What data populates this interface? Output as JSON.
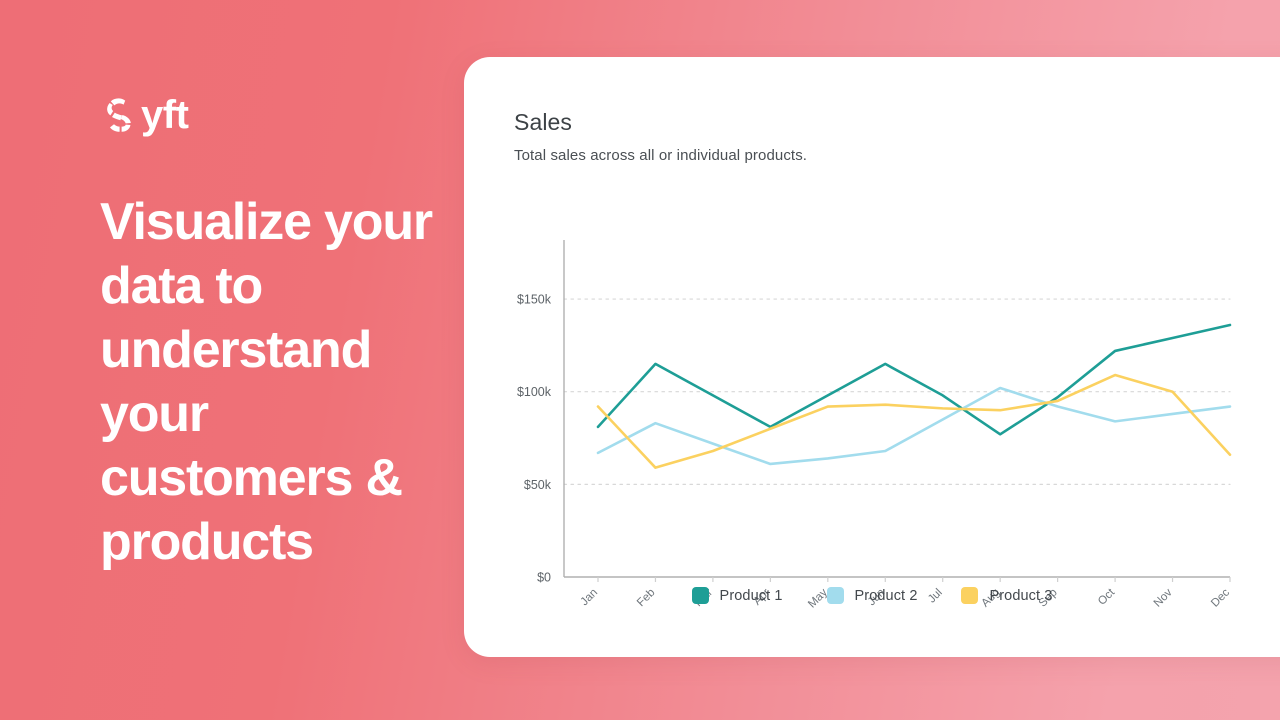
{
  "brand": {
    "logo_word": "yft",
    "logo_full": "Syft",
    "logo_mark_name": "syft-segmented-s-logo"
  },
  "hero": {
    "headline": "Visualize your data to understand your customers & products"
  },
  "card": {
    "title": "Sales",
    "subtitle": "Total sales across all or individual products."
  },
  "colors": {
    "background_start": "#ef7177",
    "background_end": "#f5a2ac",
    "card_background": "#ffffff",
    "product_1": "#1e9e96",
    "product_2": "#a2dced",
    "product_3": "#fbd160",
    "gridline": "#d8d8d8",
    "axis": "#b0b0b0",
    "text_primary": "#3d4246",
    "text_muted": "#6f767c"
  },
  "chart_data": {
    "type": "line",
    "title": "Sales",
    "subtitle": "Total sales across all or individual products.",
    "xlabel": "",
    "ylabel": "",
    "categories": [
      "Jan",
      "Feb",
      "Mar",
      "Apr",
      "May",
      "Jun",
      "Jul",
      "Aug",
      "Sep",
      "Oct",
      "Nov",
      "Dec"
    ],
    "ytick_labels": [
      "$0",
      "$50k",
      "$100k",
      "$150k"
    ],
    "ytick_values": [
      0,
      50000,
      100000,
      150000
    ],
    "ylim": [
      0,
      170000
    ],
    "grid": true,
    "grid_style": "dotted-horizontal",
    "legend_position": "bottom-center",
    "series": [
      {
        "name": "Product 1",
        "color": "#1e9e96",
        "values": [
          81000,
          115000,
          98000,
          81000,
          98000,
          115000,
          98000,
          77000,
          97000,
          122000,
          129000,
          136000
        ]
      },
      {
        "name": "Product 2",
        "color": "#a2dced",
        "values": [
          67000,
          83000,
          72000,
          61000,
          64000,
          68000,
          85000,
          102000,
          92000,
          84000,
          88000,
          92000
        ]
      },
      {
        "name": "Product 3",
        "color": "#fbd160",
        "values": [
          92000,
          59000,
          68000,
          80000,
          92000,
          93000,
          91000,
          90000,
          95000,
          109000,
          100000,
          66000
        ]
      }
    ]
  },
  "legend": [
    {
      "label": "Product 1",
      "color": "#1e9e96"
    },
    {
      "label": "Product 2",
      "color": "#a2dced"
    },
    {
      "label": "Product 3",
      "color": "#fbd160"
    }
  ]
}
